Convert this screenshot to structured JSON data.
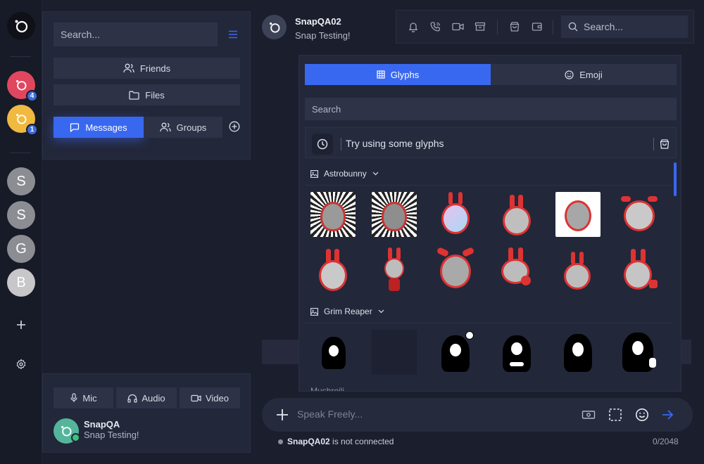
{
  "rail": {
    "servers": [
      {
        "color": "#e0475e",
        "badge": "4"
      },
      {
        "color": "#f0b93f",
        "badge": "1"
      }
    ],
    "letters": [
      {
        "letter": "S",
        "color": "#8d8d90"
      },
      {
        "letter": "S",
        "color": "#8d8d90"
      },
      {
        "letter": "G",
        "color": "#8d8d90"
      },
      {
        "letter": "B",
        "color": "#c7c7ca"
      }
    ]
  },
  "sidebar": {
    "search_placeholder": "Search...",
    "friends_label": "Friends",
    "files_label": "Files",
    "messages_tab": "Messages",
    "groups_tab": "Groups"
  },
  "user": {
    "mic_label": "Mic",
    "audio_label": "Audio",
    "video_label": "Video",
    "name": "SnapQA",
    "status": "Snap Testing!"
  },
  "chat": {
    "name": "SnapQA02",
    "status": "Snap Testing!",
    "search_placeholder": "Search..."
  },
  "glyphs": {
    "tab_glyphs": "Glyphs",
    "tab_emoji": "Emoji",
    "search_placeholder": "Search",
    "try_text": "Try using some glyphs",
    "packs": [
      {
        "name": "Astrobunny"
      },
      {
        "name": "Grim Reaper"
      }
    ],
    "third_pack_partial": "Mushroili..."
  },
  "composer": {
    "placeholder": "Speak Freely...",
    "footer_user": "SnapQA02",
    "footer_text": " is not connected",
    "counter": "0/2048"
  },
  "colors": {
    "accent": "#3968f0",
    "panel": "#23273a",
    "background": "#1b1e2d"
  }
}
